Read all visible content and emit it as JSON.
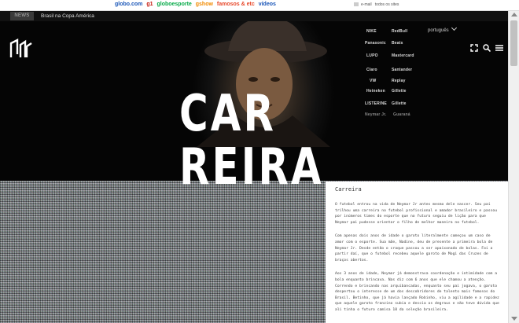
{
  "globo_bar": {
    "links": [
      "globo.com",
      "g1",
      "globoesporte",
      "gshow",
      "famosos & etc",
      "vídeos"
    ],
    "email_label": "e-mail",
    "all_sites_label": "todos os sites"
  },
  "news": {
    "tag": "NEWS",
    "headline": "Brasil na Copa América"
  },
  "header": {
    "language": "português",
    "logo_text": "njr"
  },
  "sponsors": [
    "NIKE",
    "RedBull",
    "Panasonic",
    "Beats",
    "LUPO",
    "Mastercard",
    "Claro",
    "Santander",
    "VW",
    "Replay",
    "Heineken",
    "Gillette",
    "LISTERINE",
    "Gillette",
    "Neymar Jr.",
    "Guaraná"
  ],
  "hero": {
    "title_line1": "CAR",
    "title_line2": "REIRA"
  },
  "article": {
    "title": "Carreira",
    "paragraphs": [
      "O futebol entrou na vida de Neymar Jr antes mesmo dele nascer. Seu pai trilhou uma carreira no futebol profissional e amador brasileiro e passou por inúmeros times do esporte que no futuro seguiu de lição para que Neymar pai pudesse orientar o filho de melhor maneira no futebol.",
      "Com apenas dois anos de idade o garoto literalmente começou um caso de amor com o esporte. Sua mãe, Nadine, deu de presente a primeira bola de Neymar Jr. Desde então o craque passou a ser apaixonado de bolas. Foi a partir daí, que o futebol recebeu aquele garoto de Mogi das Cruzes de braços abertos.",
      "Aos 3 anos de idade, Neymar já demonstrava coordenação e intimidade com a bola enquanto brincava. Nas diz com 6 anos que ele chamou a atenção. Correndo e brincando nas arquibancadas, enquanto seu pai jogava, o garoto despertou o interesse de um dos descobridores de talento mais famosos do Brasil. Betinho, que já havia lançado Robinho, viu a agilidade e a rapidez que aquele garoto franzino subia e descia os degraus e não teve dúvida que ali tinha o futuro camisa 10 da seleção brasileira."
    ]
  },
  "colors": {
    "accent": "#000000",
    "article_bg": "#ffffff",
    "globo_blue": "#1a56b8",
    "g1_red": "#c4170c",
    "ge_green": "#06aa48",
    "gshow_orange": "#f18a00"
  },
  "icons": [
    "nr-logo-icon",
    "expand-icon",
    "search-icon",
    "menu-icon",
    "chevron-down-icon"
  ]
}
